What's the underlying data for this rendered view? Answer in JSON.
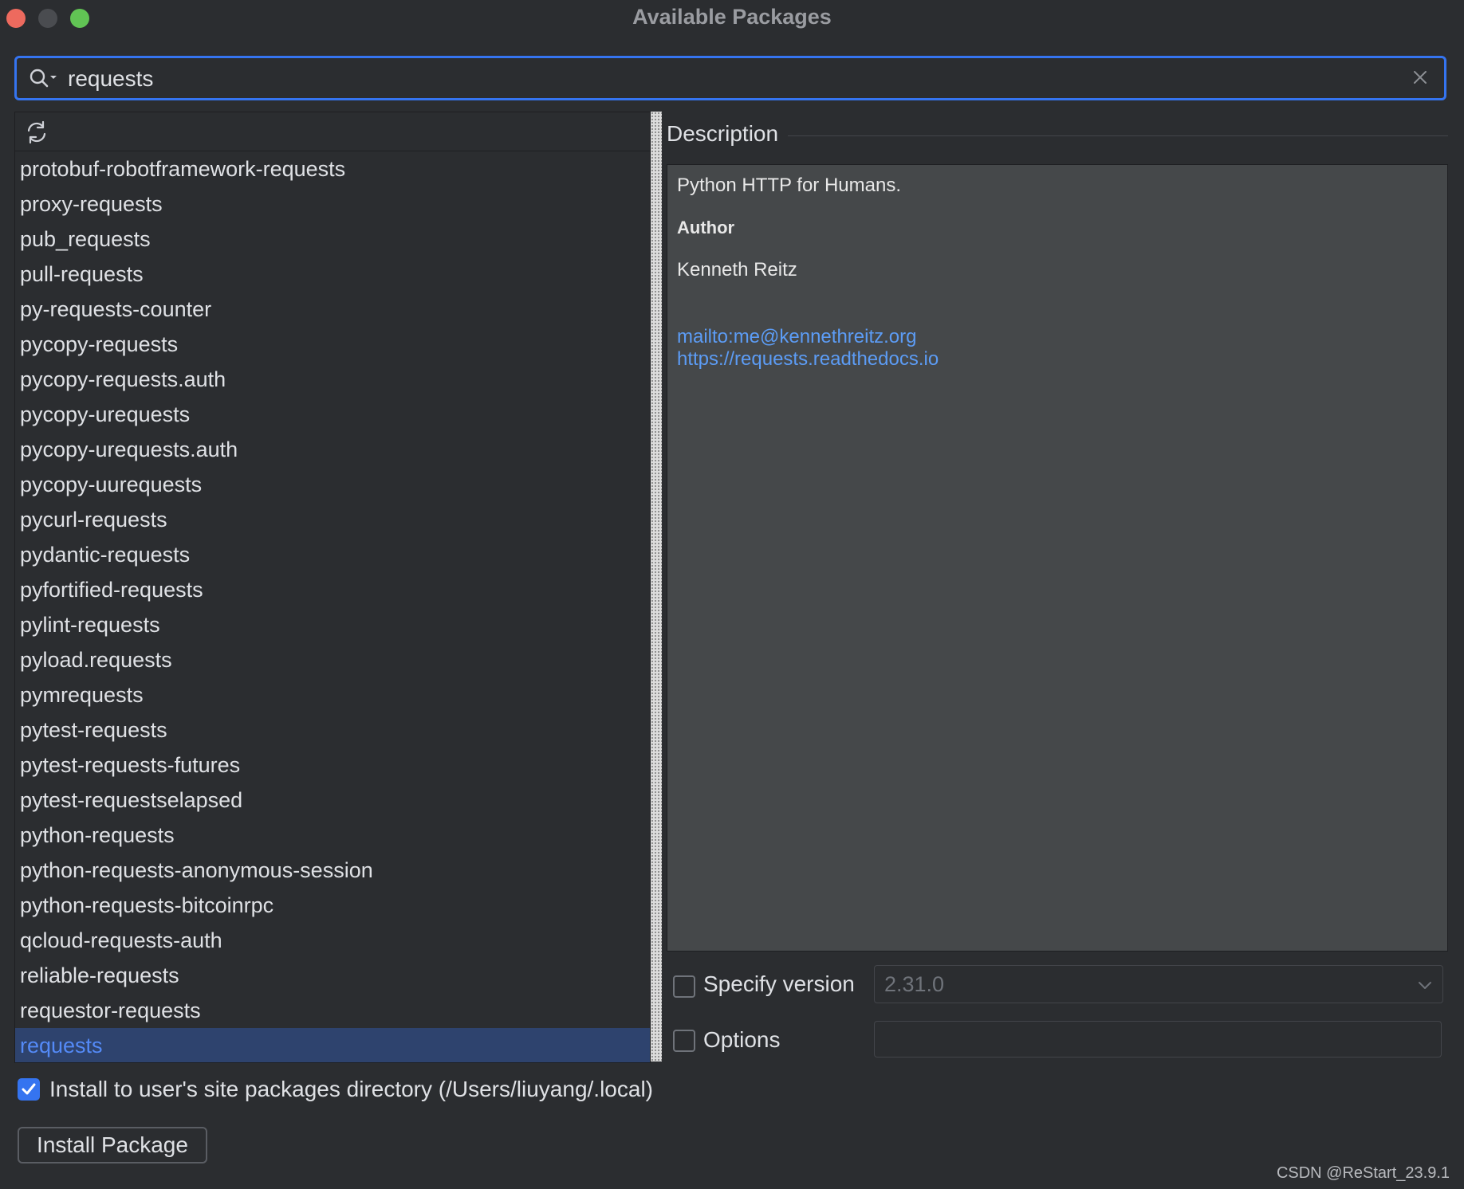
{
  "window": {
    "title": "Available Packages"
  },
  "search": {
    "value": "requests"
  },
  "packages": {
    "items": [
      "protobuf-robotframework-requests",
      "proxy-requests",
      "pub_requests",
      "pull-requests",
      "py-requests-counter",
      "pycopy-requests",
      "pycopy-requests.auth",
      "pycopy-urequests",
      "pycopy-urequests.auth",
      "pycopy-uurequests",
      "pycurl-requests",
      "pydantic-requests",
      "pyfortified-requests",
      "pylint-requests",
      "pyload.requests",
      "pymrequests",
      "pytest-requests",
      "pytest-requests-futures",
      "pytest-requestselapsed",
      "python-requests",
      "python-requests-anonymous-session",
      "python-requests-bitcoinrpc",
      "qcloud-requests-auth",
      "reliable-requests",
      "requestor-requests",
      "requests"
    ],
    "selected_index": 25
  },
  "description": {
    "heading": "Description",
    "summary": "Python HTTP for Humans.",
    "author_label": "Author",
    "author": "Kenneth Reitz",
    "email_link": "mailto:me@kennethreitz.org",
    "homepage_link": "https://requests.readthedocs.io"
  },
  "options": {
    "specify_version_label": "Specify version",
    "specify_version_checked": false,
    "version_value": "2.31.0",
    "options_label": "Options",
    "options_checked": false,
    "options_value": ""
  },
  "install": {
    "site_packages_label": "Install to user's site packages directory (/Users/liuyang/.local)",
    "site_packages_checked": true,
    "button_label": "Install Package"
  },
  "watermark": "CSDN @ReStart_23.9.1",
  "colors": {
    "accent": "#3574f0",
    "selection_bg": "#2e436e",
    "selection_text": "#548af7",
    "link": "#5c9cf5",
    "background": "#2b2d30"
  }
}
